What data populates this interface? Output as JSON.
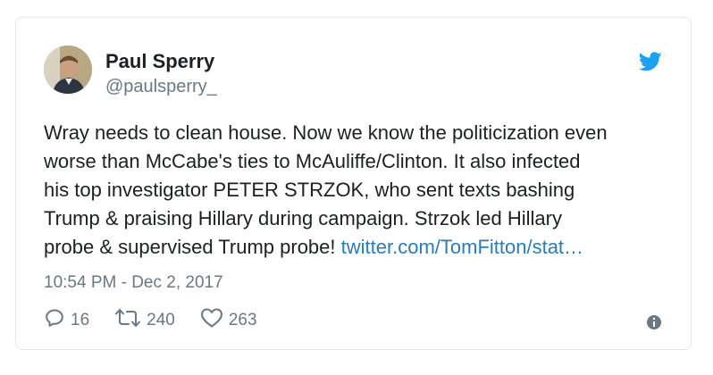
{
  "tweet": {
    "author_name": "Paul Sperry",
    "author_handle": "@paulsperry_",
    "text_lines": [
      "Wray needs to clean house. Now we know the politicization even",
      "worse than McCabe's ties to McAuliffe/Clinton. It also infected",
      "his top investigator PETER STRZOK, who sent texts bashing",
      "Trump & praising Hillary during campaign. Strzok led Hillary",
      "probe & supervised Trump probe!"
    ],
    "link_text": "twitter.com/TomFitton/stat…",
    "timestamp": "10:54 PM - Dec 2, 2017",
    "reply_count": "16",
    "retweet_count": "240",
    "like_count": "263"
  },
  "icons": {
    "brand": "twitter-bird-icon",
    "reply": "reply-icon",
    "retweet": "retweet-icon",
    "like": "heart-icon",
    "info": "info-icon"
  },
  "colors": {
    "twitter_blue": "#1da1f2",
    "link": "#2b7bb9",
    "text": "#1c2022",
    "muted": "#697882",
    "border": "#e1e8ed"
  }
}
